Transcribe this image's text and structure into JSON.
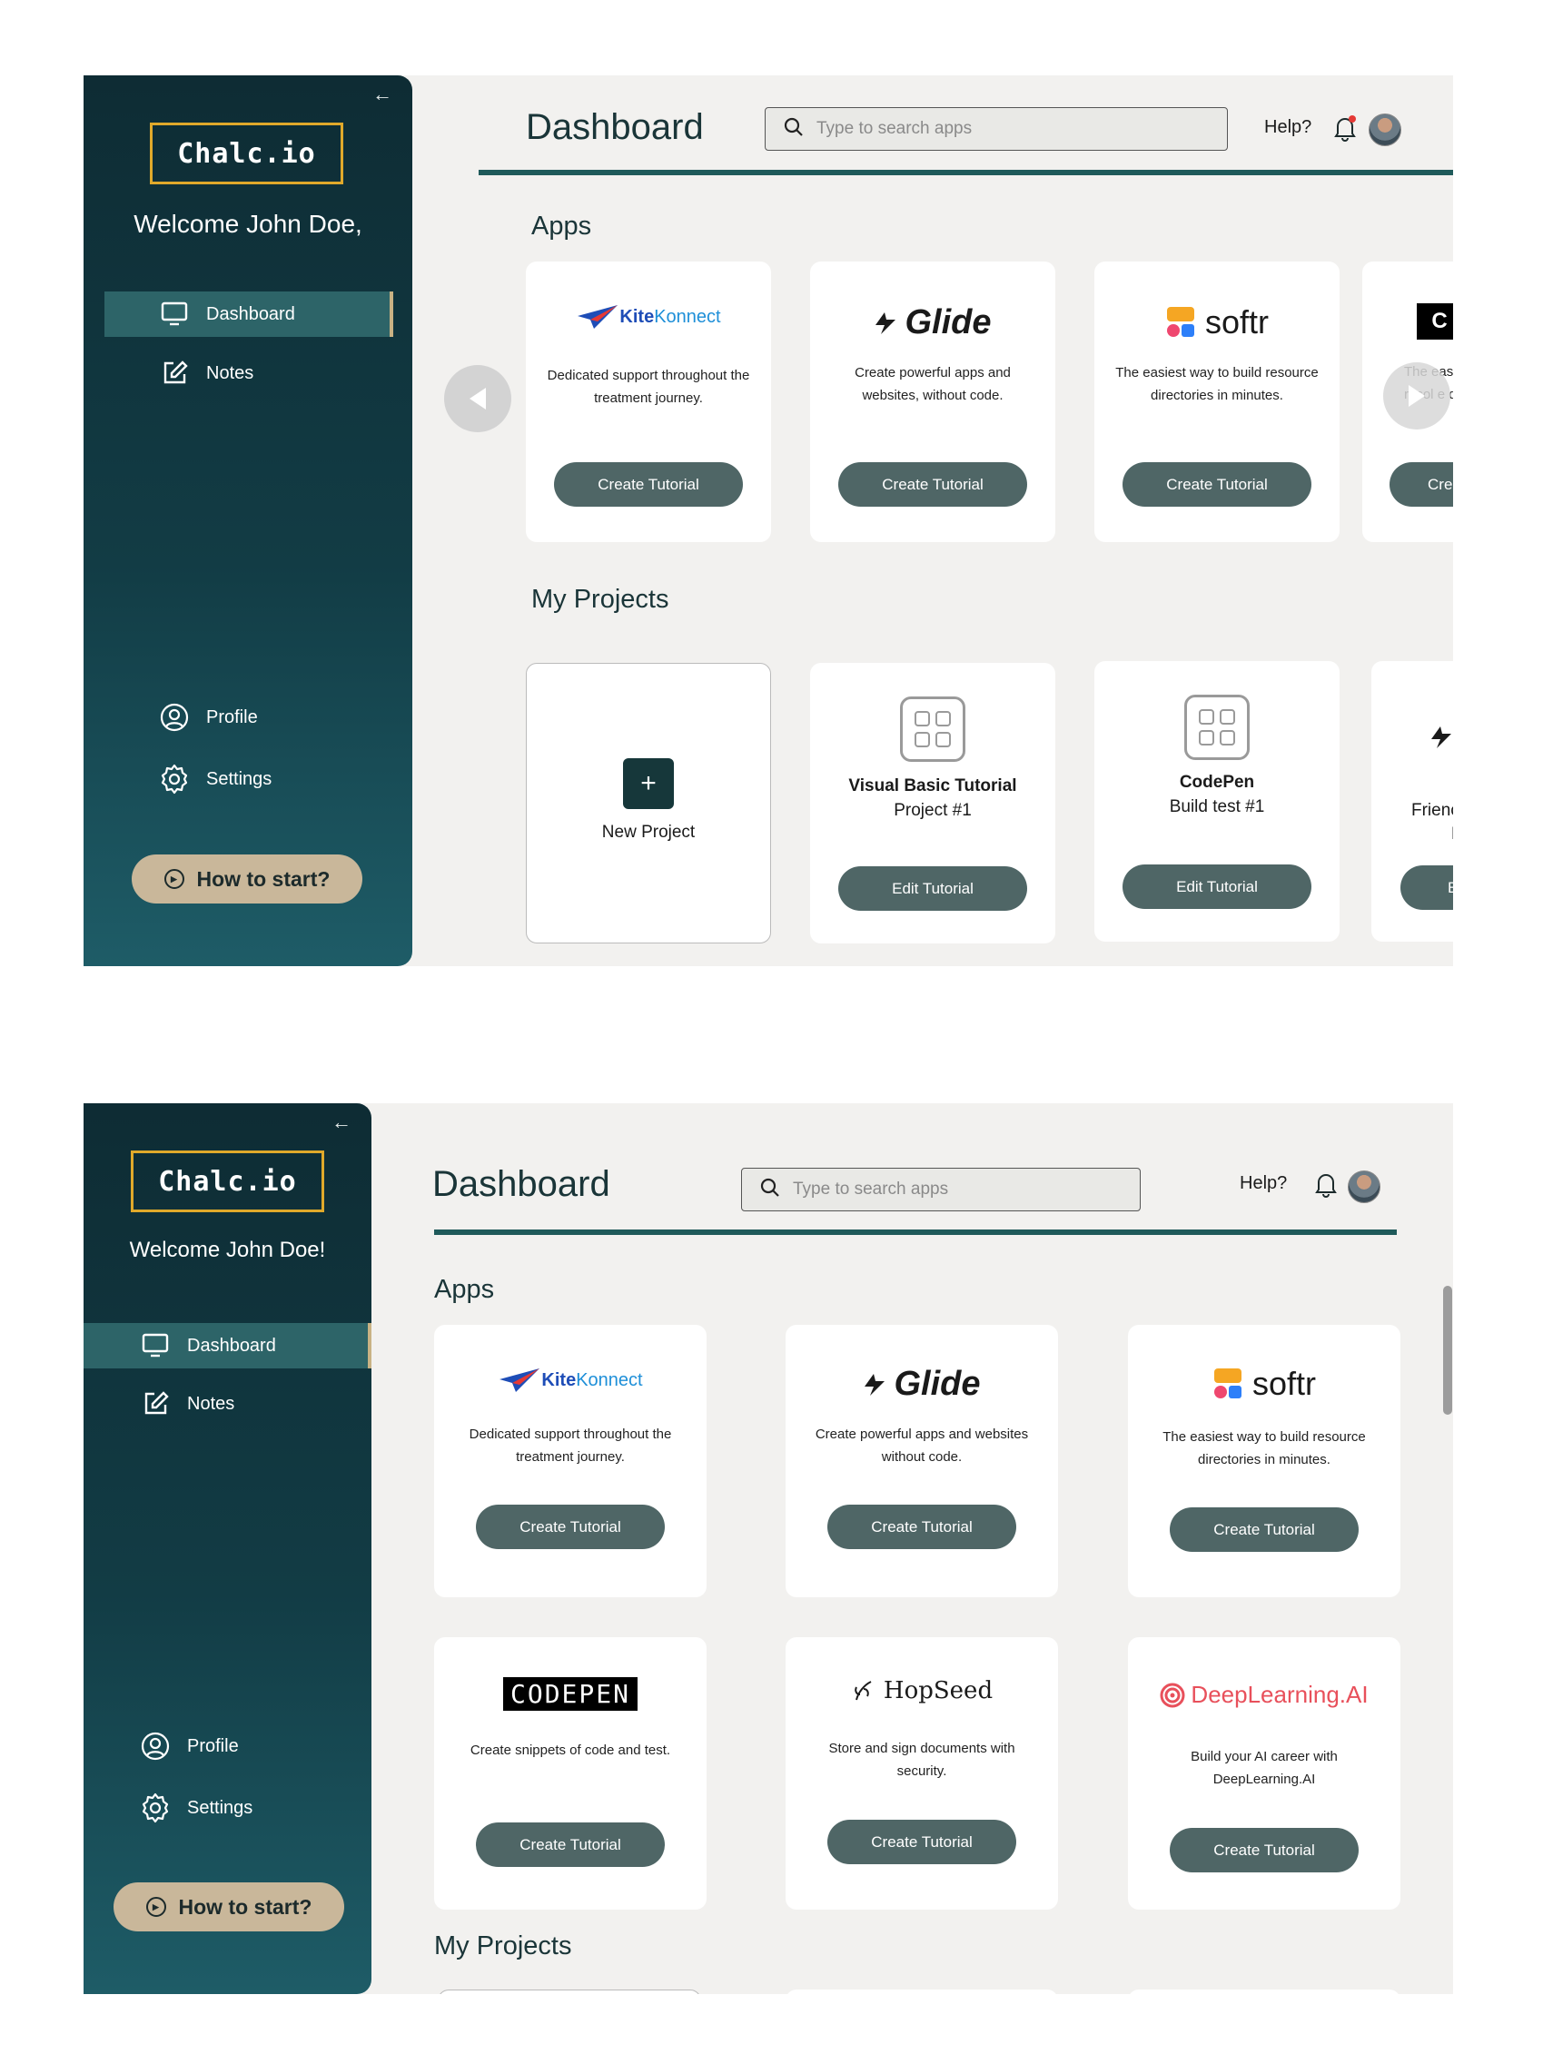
{
  "brand": {
    "logo_text": "Chalc.io"
  },
  "sidebar": {
    "welcome_v1": "Welcome John Doe,",
    "welcome_v2": "Welcome John Doe!",
    "nav": [
      {
        "label": "Dashboard",
        "icon": "monitor-icon"
      },
      {
        "label": "Notes",
        "icon": "edit-note-icon"
      },
      {
        "label": "Profile",
        "icon": "user-circle-icon"
      },
      {
        "label": "Settings",
        "icon": "gear-icon"
      }
    ],
    "how_to_label": "How to start?"
  },
  "header": {
    "title": "Dashboard",
    "search_placeholder": "Type to search apps",
    "help_label": "Help?"
  },
  "sections": {
    "apps_title": "Apps",
    "projects_title": "My Projects"
  },
  "apps": [
    {
      "name": "KiteKonnect",
      "logo_a": "Kite",
      "logo_b": "Konnect",
      "desc_v1": "Dedicated support throughout the treatment journey.",
      "desc_v2": "Dedicated support throughout the treatment journey.",
      "button": "Create Tutorial"
    },
    {
      "name": "Glide",
      "desc_v1": "Create powerful apps and websites, without code.",
      "desc_v2": "Create powerful apps and websites without code.",
      "button": "Create Tutorial"
    },
    {
      "name": "softr",
      "desc_v1": "The easiest way to build resource directories in minutes.",
      "desc_v2": "The easiest way to build resource directories in minutes.",
      "button": "Create Tutorial"
    },
    {
      "name": "CODEPEN",
      "desc": "Create snippets of code and test.",
      "partial_desc_1": "The eas",
      "partial_desc_2": "resol",
      "partial_desc_3": "e dir",
      "partial_button": "Crea",
      "button": "Create Tutorial"
    },
    {
      "name": "HopSeed",
      "desc": "Store and sign documents with security.",
      "button": "Create Tutorial"
    },
    {
      "name": "DeepLearning.AI",
      "desc": "Build your AI career with DeepLearning.AI",
      "button": "Create Tutorial"
    }
  ],
  "projects": {
    "new_label": "New Project",
    "items": [
      {
        "title": "Visual Basic Tutorial",
        "subtitle": "Project #1",
        "button": "Edit Tutorial"
      },
      {
        "title": "CodePen",
        "subtitle": "Build test #1",
        "button": "Edit Tutorial"
      },
      {
        "partial_title": "Frienc",
        "partial_subtitle": "E",
        "partial_button": "E"
      }
    ]
  },
  "colors": {
    "sidebar_top": "#0e2c34",
    "sidebar_bottom": "#1e5c67",
    "accent_gold": "#e0a92b",
    "button": "#4f6666",
    "howto_bg": "#c9b79a",
    "bell_dot": "#e53935"
  }
}
